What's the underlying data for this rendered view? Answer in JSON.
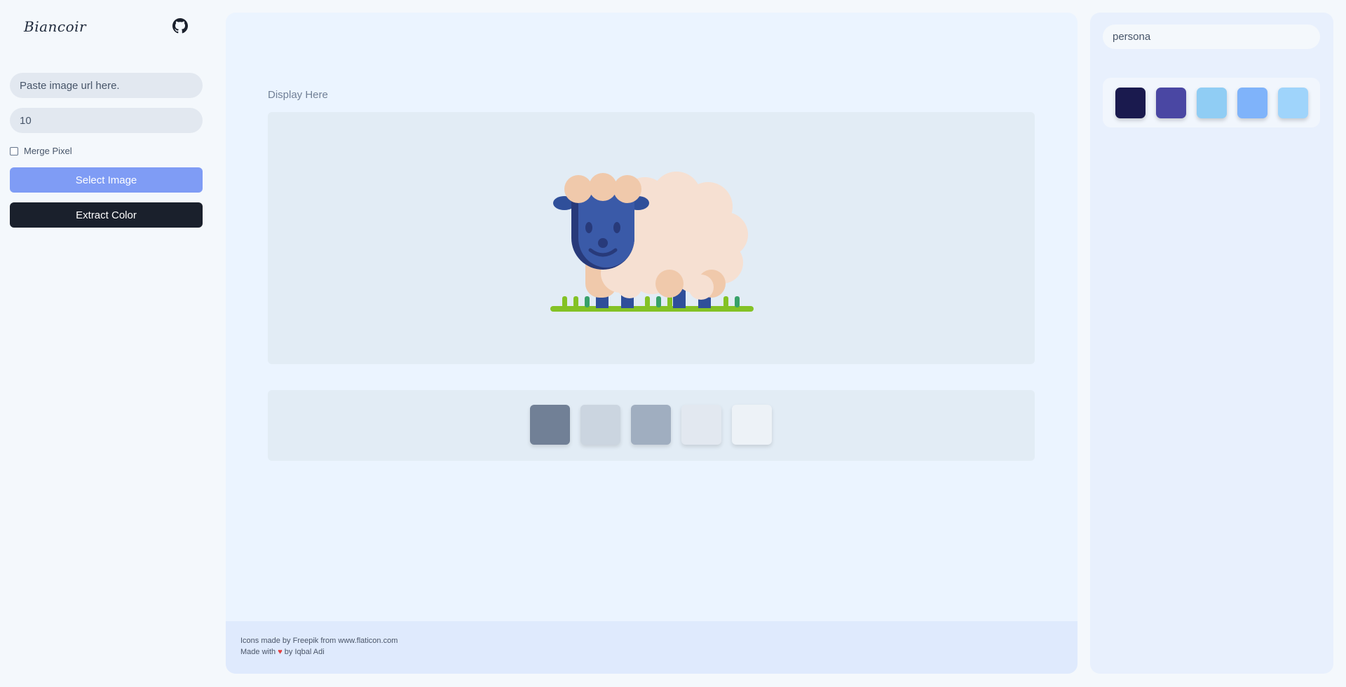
{
  "sidebar": {
    "logo": "Biancoir",
    "github_icon": "github-icon",
    "url_placeholder": "Paste image url here.",
    "number_value": "10",
    "merge_label": "Merge Pixel",
    "merge_checked": false,
    "select_button": "Select Image",
    "extract_button": "Extract Color"
  },
  "main": {
    "display_label": "Display Here",
    "image_icon": "sheep-icon",
    "palette": [
      "#718096",
      "#cbd5e0",
      "#a0aec0",
      "#e2e8f0",
      "#edf2f7"
    ],
    "footer": {
      "credit": "Icons made by Freepik from www.flaticon.com",
      "made_with_prefix": "Made with",
      "made_with_suffix": "by Iqbal Adi"
    }
  },
  "right": {
    "search_value": "persona",
    "palette": [
      "#1a1a4e",
      "#4a47a3",
      "#90cdf4",
      "#7fb3fa",
      "#9fd4fb"
    ]
  },
  "colors": {
    "accent": "#7f9cf5",
    "dark": "#1a202c",
    "main_bg": "#ebf4ff"
  }
}
